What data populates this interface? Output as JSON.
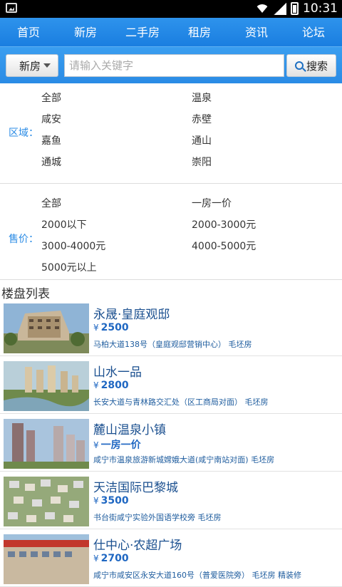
{
  "status_bar": {
    "time": "10:31"
  },
  "nav": {
    "items": [
      "首页",
      "新房",
      "二手房",
      "租房",
      "资讯",
      "论坛"
    ]
  },
  "search": {
    "type_label": "新房",
    "placeholder": "请输入关键字",
    "button_label": "搜索"
  },
  "filters": {
    "region": {
      "label": "区域：",
      "options": [
        "全部",
        "温泉",
        "咸安",
        "赤壁",
        "嘉鱼",
        "通山",
        "通城",
        "崇阳"
      ]
    },
    "price": {
      "label": "售价：",
      "options": [
        "全部",
        "一房一价",
        "2000以下",
        "2000-3000元",
        "3000-4000元",
        "4000-5000元",
        "5000元以上"
      ]
    }
  },
  "list": {
    "title": "楼盘列表",
    "currency": "¥",
    "items": [
      {
        "name": "永晟·皇庭观邸",
        "price": "2500",
        "address": "马柏大道138号（皇庭观邸营销中心） 毛坯房"
      },
      {
        "name": "山水一品",
        "price": "2800",
        "address": "长安大道与青林路交汇处（区工商局对面） 毛坯房"
      },
      {
        "name": "麓山温泉小镇",
        "price": "一房一价",
        "address": "咸宁市温泉旅游新城嫦娥大道(咸宁南站对面) 毛坯房"
      },
      {
        "name": "天洁国际巴黎城",
        "price": "3500",
        "address": "书台街咸宁实验外国语学校旁 毛坯房"
      },
      {
        "name": "仕中心·农超广场",
        "price": "2700",
        "address": "咸宁市咸安区永安大道160号（普爱医院旁） 毛坯房 精装修"
      }
    ]
  },
  "colors": {
    "nav_blue": "#2a8be5",
    "label_blue": "#2a8be5",
    "title_blue": "#1a4f8f"
  }
}
